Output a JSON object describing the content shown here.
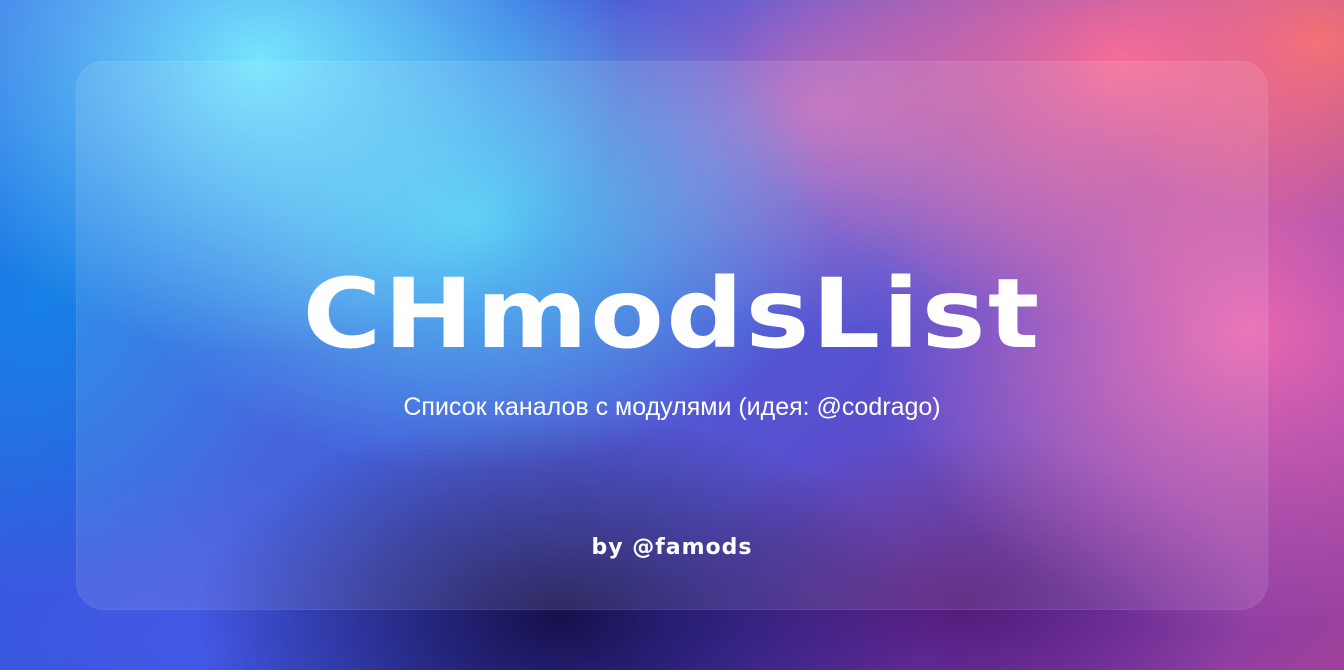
{
  "banner": {
    "title": "CHmodsList",
    "subtitle": "Список каналов с модулями (идея: @codrago)",
    "author": "by @famods"
  },
  "colors": {
    "text": "#ffffff",
    "gradient_cyan": "#78ebff",
    "gradient_blue": "#3050d8",
    "gradient_pink": "#f069af",
    "gradient_coral": "#ff7850",
    "gradient_navy": "#140f46"
  }
}
